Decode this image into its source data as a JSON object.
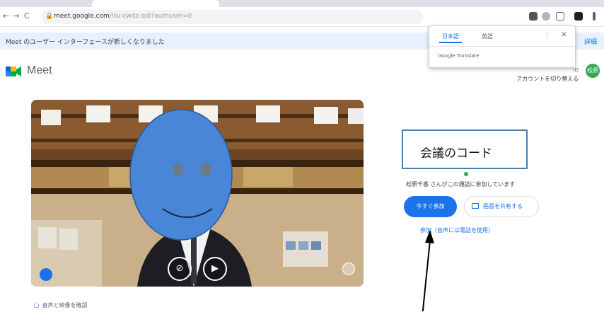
{
  "browser": {
    "back": "←",
    "forward": "→",
    "reload": "C",
    "lock": "🔒",
    "url_main": "meet.google.com",
    "url_rest": "/lsv-cwdz-qdi?authuser=0",
    "extension_colors": [
      "#555555",
      "#5f6368",
      "#5f6368",
      "#202124"
    ]
  },
  "notice": {
    "text": "Meet のユーザー インターフェースが新しくなりました",
    "link": "詳細"
  },
  "translate_popup": {
    "tab_japanese": "日本語",
    "tab_english": "英語",
    "menu": "⋮",
    "close": "✕",
    "brand": "Google Translate"
  },
  "header": {
    "logo_icon": "meet-logo-icon",
    "title": "Meet",
    "account_line1": "ID",
    "account_line2": "アカウントを切り替える",
    "avatar": "松原"
  },
  "preview": {
    "mic_icon": "mic-off-icon",
    "camera_icon": "camera-icon",
    "more_icon": "more-options-icon",
    "effects_icon": "effects-icon"
  },
  "check_audio_video": "音声と映像を確認",
  "callout": {
    "text": "会議のコード"
  },
  "join": {
    "status": "松原千香 さんがこの通話に参加しています",
    "join_button": "今すぐ参加",
    "present_button": "画面を共有する",
    "other_join": "参加（音声には電話を使用）"
  },
  "colors": {
    "accent": "#1a73e8",
    "avatar_green": "#34a853",
    "callout_border": "#4a7ea8",
    "face_blue": "#4a86d8"
  }
}
